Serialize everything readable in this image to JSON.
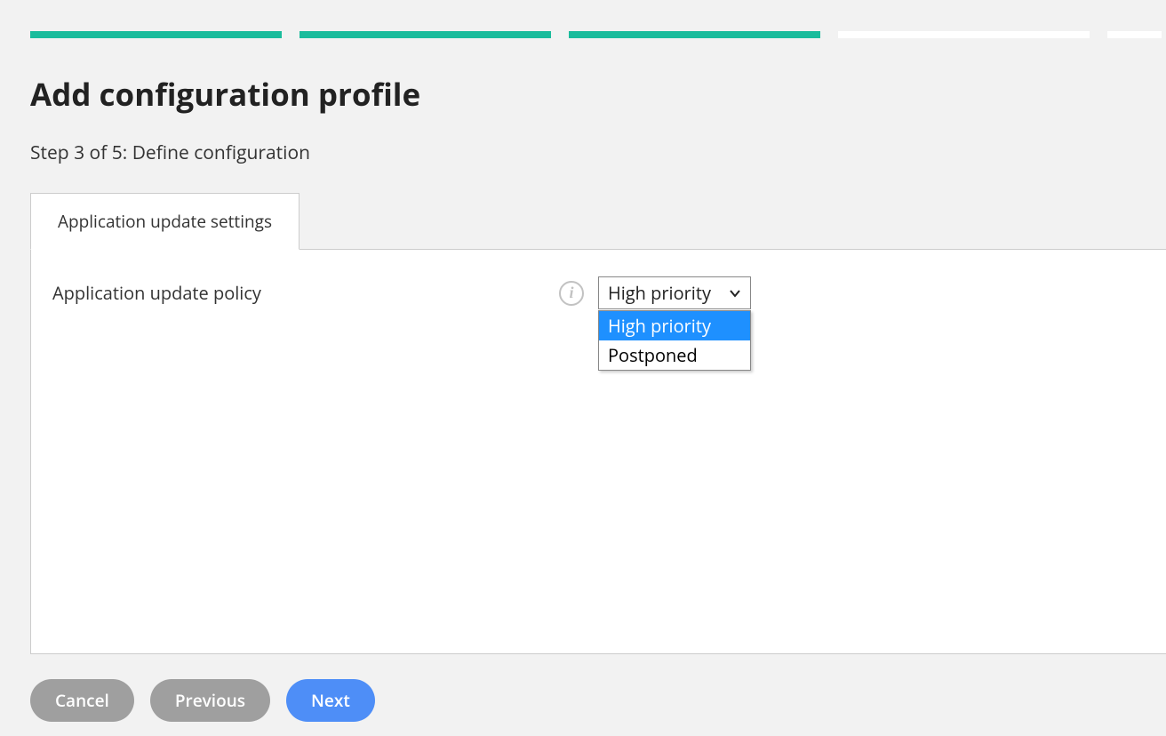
{
  "page_title": "Add configuration profile",
  "step_label": "Step 3 of 5: Define configuration",
  "progress": {
    "total": 5,
    "current": 3
  },
  "tabs": [
    {
      "label": "Application update settings",
      "active": true
    }
  ],
  "form": {
    "update_policy_label": "Application update policy",
    "update_policy_select": {
      "selected": "High priority",
      "options": [
        "High priority",
        "Postponed"
      ],
      "highlighted": "High priority"
    }
  },
  "buttons": {
    "cancel": "Cancel",
    "previous": "Previous",
    "next": "Next"
  },
  "colors": {
    "progress_done": "#1abc9c",
    "primary_button": "#4e8ef7",
    "secondary_button": "#9f9f9f",
    "dropdown_highlight": "#1e90ff"
  }
}
